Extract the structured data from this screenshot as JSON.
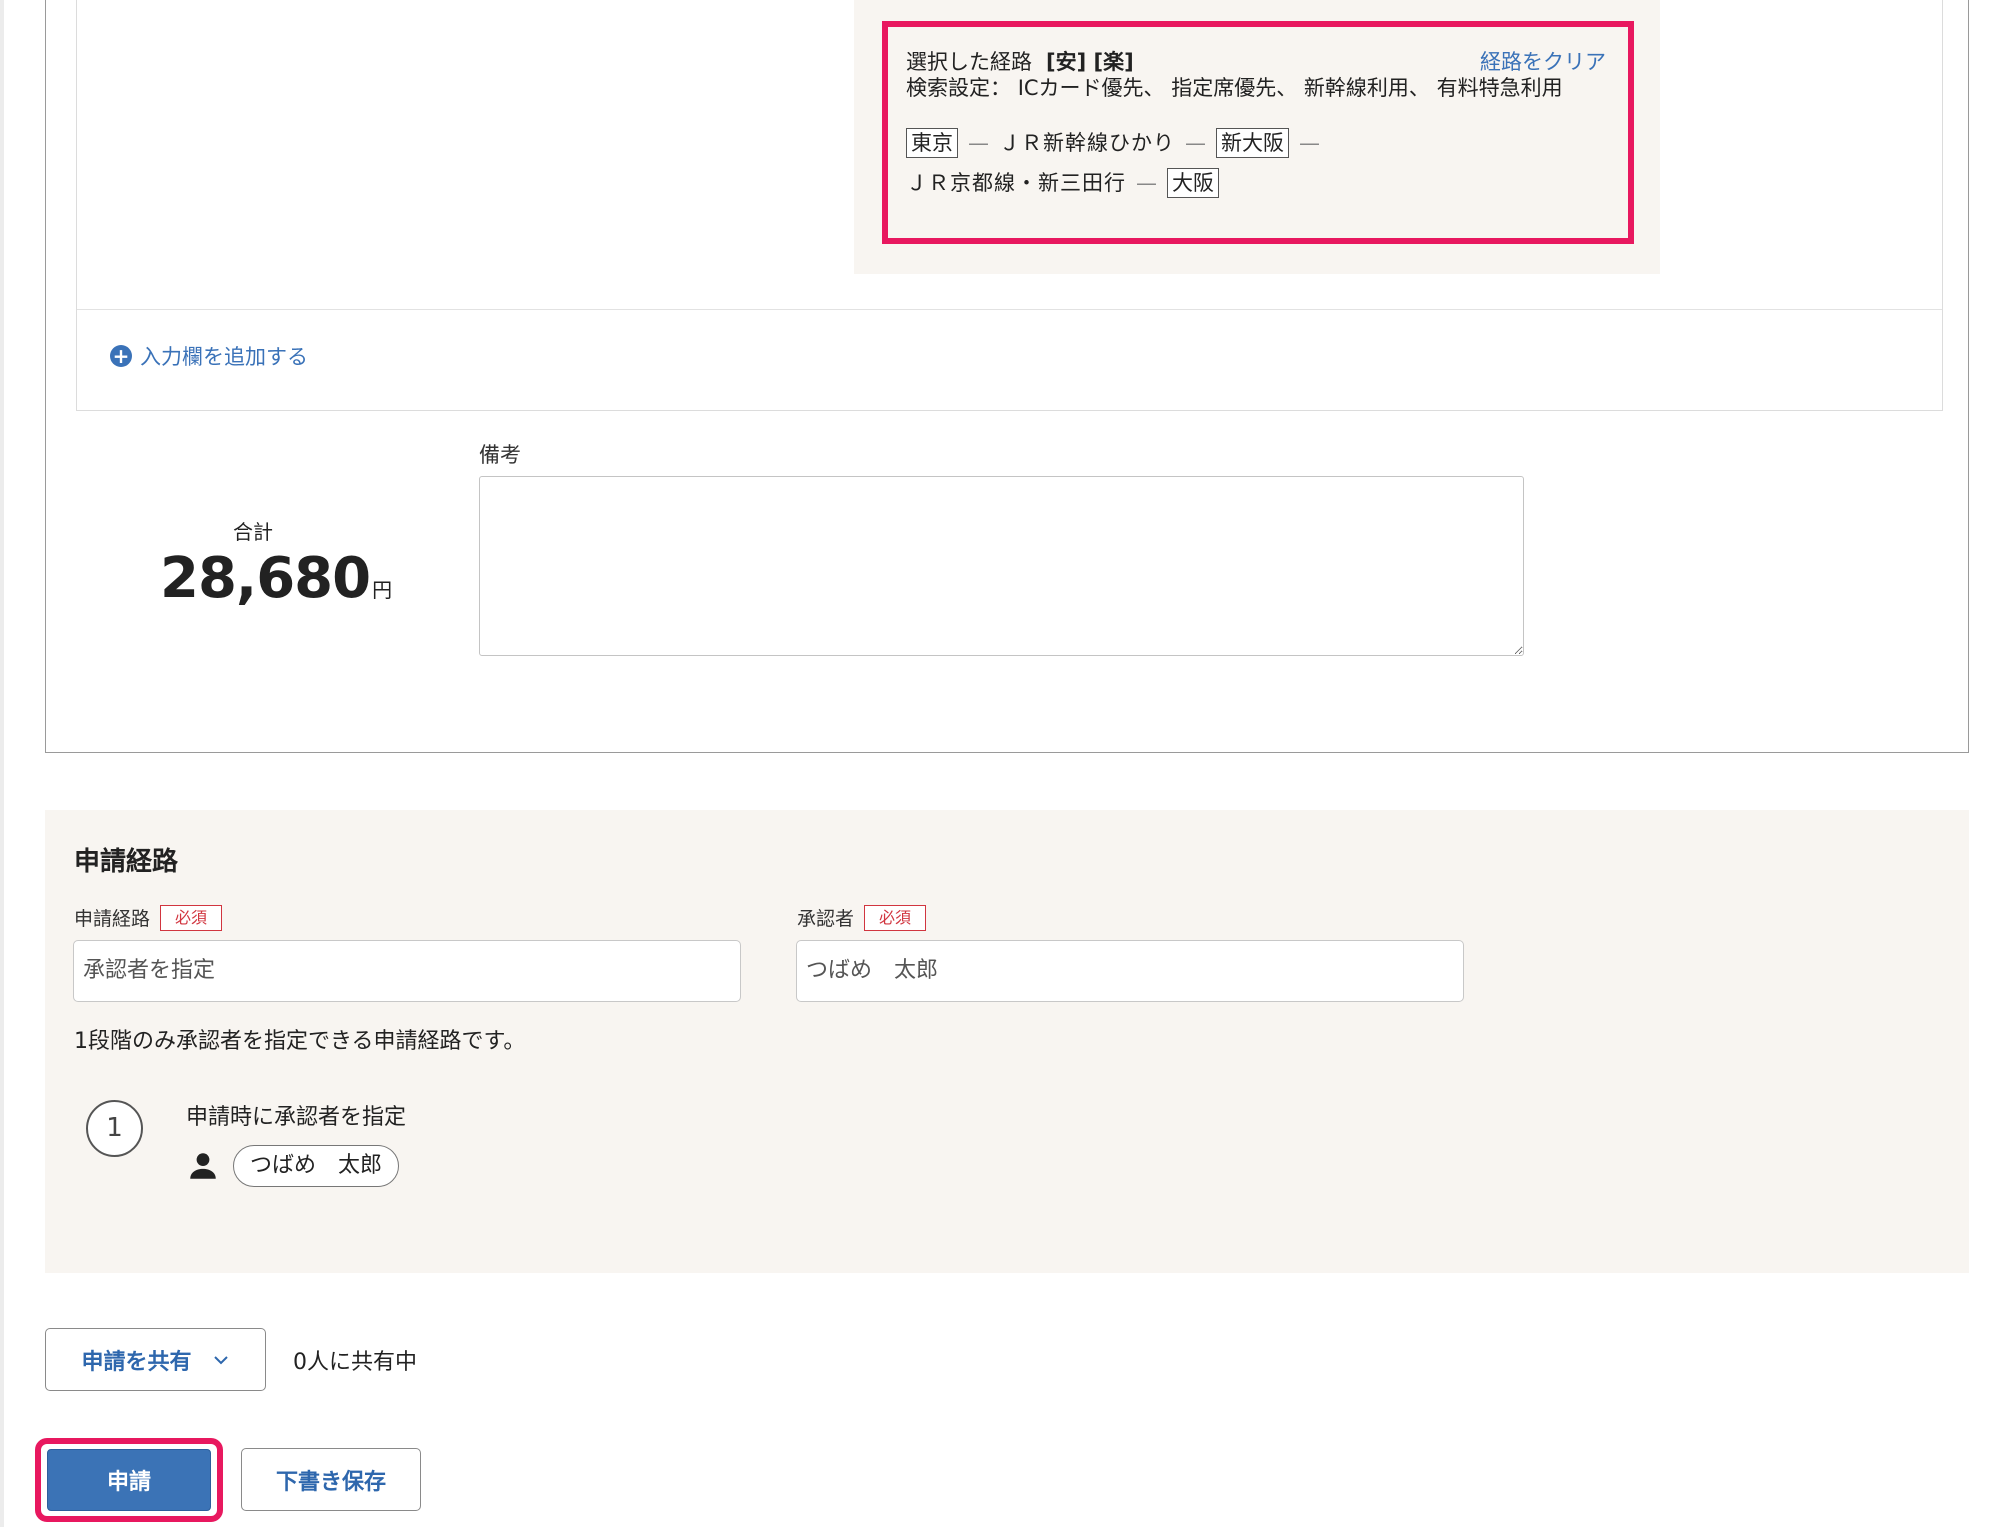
{
  "route": {
    "title": "選択した経路",
    "tags": "[安] [楽]",
    "clear_link": "経路をクリア",
    "settings_label": "検索設定：",
    "settings_value": "ICカード優先、 指定席優先、 新幹線利用、 有料特急利用",
    "stations": [
      "東京",
      "新大阪",
      "大阪"
    ],
    "lines": [
      "ＪＲ新幹線ひかり",
      "ＪＲ京都線・新三田行"
    ],
    "dash": "—"
  },
  "add_row": {
    "label": "入力欄を追加する"
  },
  "total": {
    "label": "合計",
    "amount": "28,680",
    "unit": "円"
  },
  "notes": {
    "label": "備考",
    "value": ""
  },
  "approval": {
    "section_title": "申請経路",
    "route_label": "申請経路",
    "route_required": "必須",
    "route_value": "承認者を指定",
    "approver_label": "承認者",
    "approver_required": "必須",
    "approver_value": "つばめ　太郎",
    "help_text": "1段階のみ承認者を指定できる申請経路です。",
    "step_number": "1",
    "step_desc": "申請時に承認者を指定",
    "step_approver": "つばめ　太郎"
  },
  "share": {
    "button_label": "申請を共有",
    "status": "0人に共有中"
  },
  "actions": {
    "submit_label": "申請",
    "draft_label": "下書き保存"
  },
  "colors": {
    "accent": "#3b73b6",
    "highlight": "#e8185f",
    "required": "#d1353f",
    "panel_bg": "#f8f5f1"
  }
}
